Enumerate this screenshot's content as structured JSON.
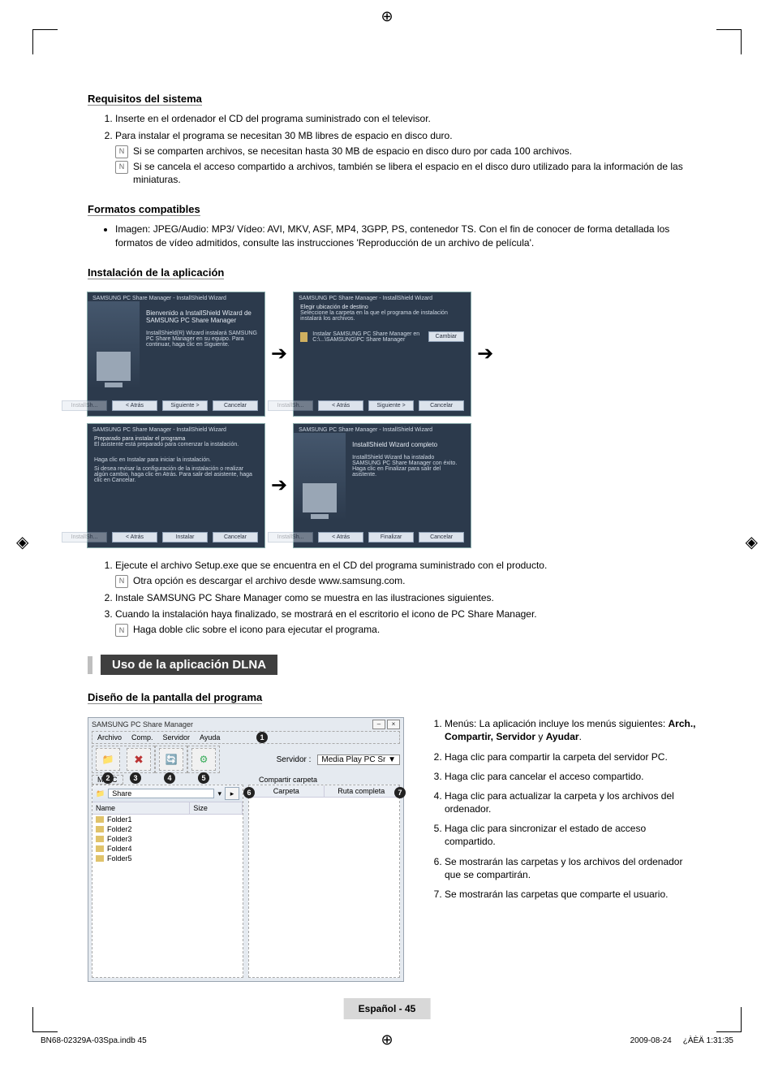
{
  "sections": {
    "sys_title": "Requisitos del sistema",
    "sys_items": {
      "i1": "Inserte en el ordenador el CD del programa suministrado con el televisor.",
      "i2": "Para instalar el programa se necesitan 30 MB libres de espacio en disco duro.",
      "i2_n1": "Si se comparten archivos, se necesitan hasta 30 MB de espacio en disco duro por cada 100 archivos.",
      "i2_n2": "Si se cancela el acceso compartido a archivos, también se libera el espacio en el disco duro utilizado para la información de las miniaturas."
    },
    "fmt_title": "Formatos compatibles",
    "fmt_body": "Imagen: JPEG/Audio: MP3/ Vídeo: AVI, MKV, ASF, MP4, 3GPP, PS, contenedor TS. Con el fin de conocer de forma detallada los formatos de vídeo admitidos, consulte las instrucciones 'Reproducción de un archivo de película'.",
    "inst_title": "Instalación de la aplicación"
  },
  "wizard": {
    "title": "SAMSUNG PC Share Manager - InstallShield Wizard",
    "step1_head": "Bienvenido a InstallShield Wizard de SAMSUNG PC Share Manager",
    "step1_body": "InstallShield(R) Wizard instalará SAMSUNG PC Share Manager en su equipo. Para continuar, haga clic en Siguiente.",
    "step2_head": "Elegir ubicación de destino",
    "step2_sub": "Seleccione la carpeta en la que el programa de instalación instalará los archivos.",
    "step2_path": "Instalar SAMSUNG PC Share Manager en  C:\\...\\SAMSUNG\\PC Share Manager",
    "step2_cambiar": "Cambiar",
    "step3_head": "Preparado para instalar el programa",
    "step3_sub": "El asistente está preparado para comenzar la instalación.",
    "step3_body1": "Haga clic en Instalar para iniciar la instalación.",
    "step3_body2": "Si desea revisar la configuración de la instalación o realizar algún cambio, haga clic en Atrás. Para salir del asistente, haga clic en Cancelar.",
    "step4_head": "InstallShield Wizard completo",
    "step4_body": "InstallShield Wizard ha instalado SAMSUNG PC Share Manager con éxito. Haga clic en Finalizar para salir del asistente.",
    "btn_atras": "< Atrás",
    "btn_sig": "Siguiente >",
    "btn_cancel": "Cancelar",
    "btn_instalar": "Instalar",
    "btn_finalizar": "Finalizar",
    "btn_install_left": "InstallSh..."
  },
  "post_install": {
    "i1": "Ejecute el archivo Setup.exe que se encuentra en el CD del programa suministrado con el producto.",
    "i1_note": "Otra opción es descargar el archivo desde www.samsung.com.",
    "i2": "Instale SAMSUNG PC Share Manager como se muestra en las ilustraciones siguientes.",
    "i3": "Cuando la instalación haya finalizado, se mostrará en el escritorio el icono de PC Share Manager.",
    "i3_note": "Haga doble clic sobre el icono para ejecutar el programa."
  },
  "dlna": {
    "bar": "Uso de la aplicación DLNA",
    "subtitle": "Diseño de la pantalla del programa"
  },
  "app": {
    "title": "SAMSUNG PC Share Manager",
    "menu": {
      "m1": "Archivo",
      "m2": "Comp.",
      "m3": "Servidor",
      "m4": "Ayuda"
    },
    "server_label": "Servidor :",
    "server_value": "Media Play PC Sr ▼",
    "left_panel_label": "Mi PC",
    "right_panel_label": "Compartir carpeta",
    "share_placeholder": "Share",
    "cols": {
      "name": "Name",
      "size": "Size",
      "carpeta": "Carpeta",
      "ruta": "Ruta completa"
    },
    "folders": [
      "Folder1",
      "Folder2",
      "Folder3",
      "Folder4",
      "Folder5"
    ]
  },
  "desc": {
    "d1_a": "Menús: La aplicación incluye los menús siguientes: ",
    "d1_b": "Arch., Compartir, Servidor",
    "d1_c": " y ",
    "d1_d": "Ayudar",
    "d1_e": ".",
    "d2": "Haga clic para compartir la carpeta del servidor PC.",
    "d3": "Haga clic para cancelar el acceso compartido.",
    "d4": "Haga clic para actualizar la carpeta y los archivos del ordenador.",
    "d5": "Haga clic para sincronizar el estado de acceso compartido.",
    "d6": "Se mostrarán las carpetas y los archivos del ordenador que se compartirán.",
    "d7": "Se mostrarán las carpetas que comparte el usuario."
  },
  "badges": {
    "b1": "1",
    "b2": "2",
    "b3": "3",
    "b4": "4",
    "b5": "5",
    "b6": "6",
    "b7": "7"
  },
  "footer": {
    "page": "Español - 45",
    "file": "BN68-02329A-03Spa.indb   45",
    "date": "2009-08-24",
    "time": "¿ÀÈÄ 1:31:35"
  },
  "note_glyph": "N"
}
